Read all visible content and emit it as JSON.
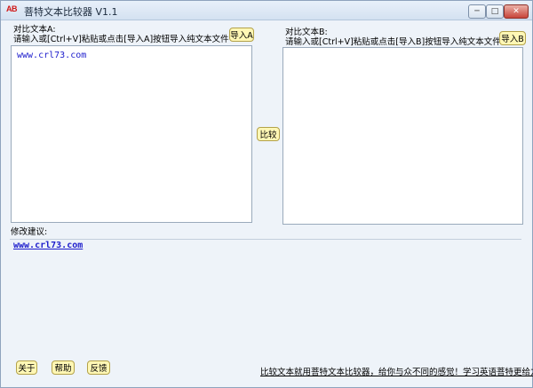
{
  "window": {
    "icon_text": "AB",
    "title": "菩特文本比较器 V1.1",
    "controls": {
      "minimize": "─",
      "maximize": "□",
      "close": "✕"
    }
  },
  "panel_a": {
    "heading": "对比文本A:",
    "instruction": "请输入或[Ctrl+V]粘贴或点击[导入A]按钮导入纯文本文件",
    "import_label": "导入A",
    "text": "www.crl73.com"
  },
  "panel_b": {
    "heading": "对比文本B:",
    "instruction": "请输入或[Ctrl+V]粘贴或点击[导入B]按钮导入纯文本文件",
    "import_label": "导入B",
    "text": ""
  },
  "compare_label": "比较",
  "suggestions": {
    "heading": "修改建议:",
    "text": "www.crl73.com"
  },
  "footer": {
    "about_label": "关于",
    "help_label": "帮助",
    "feedback_label": "反馈",
    "promo_text": "比较文本就用菩特文本比较器，给你与众不同的感觉！学习英语菩特更给力！"
  }
}
